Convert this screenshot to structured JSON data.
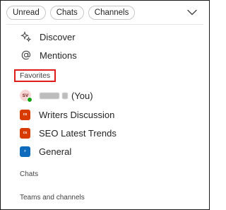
{
  "filters": [
    {
      "label": "Unread"
    },
    {
      "label": "Chats"
    },
    {
      "label": "Channels"
    }
  ],
  "nav": {
    "discover": "Discover",
    "mentions": "Mentions"
  },
  "favorites": {
    "heading": "Favorites",
    "highlight_color": "#e01b1b",
    "self": {
      "initials": "SV",
      "suffix": "(You)",
      "presence": "available"
    },
    "items": [
      {
        "label": "Writers Discussion",
        "icon_text": "cs",
        "color": "#d83b01"
      },
      {
        "label": "SEO Latest Trends",
        "icon_text": "cs",
        "color": "#d83b01"
      },
      {
        "label": "General",
        "icon_text": "r",
        "color": "#0f6cbd"
      }
    ]
  },
  "sections": {
    "chats": "Chats",
    "teams": "Teams and channels"
  },
  "icons": {
    "filter_menu": "chevron-down-icon",
    "discover": "sparkle-icon",
    "mentions": "at-sign-icon"
  }
}
